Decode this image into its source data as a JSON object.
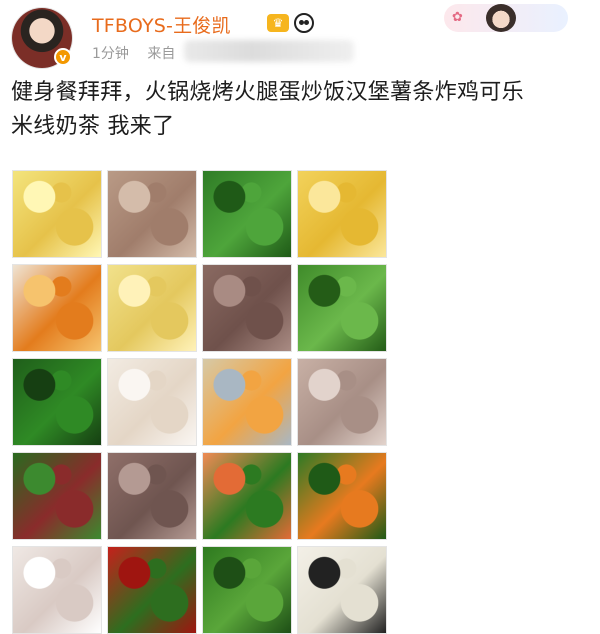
{
  "header": {
    "username": "TFBOYS-王俊凯",
    "time": "1分钟",
    "source_prefix": "来自",
    "verified_badge": "v",
    "crown_icon": "crown-icon",
    "panda_icon": "panda-icon"
  },
  "post": {
    "text_line1": "健身餐拜拜，火锅烧烤火腿蛋炒饭汉堡薯条炸鸡可乐",
    "text_line2": "米线奶茶 我来了"
  },
  "photos": [
    {
      "name": "cabbage-photo",
      "colors": [
        "#f3e47d",
        "#e6c24a",
        "#fff7b5"
      ]
    },
    {
      "name": "meat-photo-1",
      "colors": [
        "#b99a86",
        "#a07d6b",
        "#d4bcaa"
      ]
    },
    {
      "name": "greens-photo-1",
      "colors": [
        "#2f7c26",
        "#4ea53b",
        "#1f5a17"
      ]
    },
    {
      "name": "corn-photo",
      "colors": [
        "#f2d25b",
        "#e5b832",
        "#fbe79b"
      ]
    },
    {
      "name": "chicken-pumpkin-photo",
      "colors": [
        "#efe3d3",
        "#e37c1d",
        "#f6c36d"
      ]
    },
    {
      "name": "cabbage-photo-2",
      "colors": [
        "#f1e18b",
        "#e4c85e",
        "#fff2b9"
      ]
    },
    {
      "name": "beef-photo-1",
      "colors": [
        "#8a6a62",
        "#6f514b",
        "#a98b83"
      ]
    },
    {
      "name": "snap-peas-photo",
      "colors": [
        "#3f8b2a",
        "#6bb84b",
        "#245c17"
      ]
    },
    {
      "name": "spinach-photo",
      "colors": [
        "#1f5e1a",
        "#2f8a25",
        "#163f12"
      ]
    },
    {
      "name": "chicken-photo-2",
      "colors": [
        "#f2ebe2",
        "#e4d6c6",
        "#faf6f2"
      ]
    },
    {
      "name": "lunchbox-photo",
      "colors": [
        "#d6c9a6",
        "#f2a442",
        "#a9b7c3"
      ]
    },
    {
      "name": "meat-photo-2",
      "colors": [
        "#c8b0a5",
        "#a88f86",
        "#e2d3cc"
      ]
    },
    {
      "name": "spinach-tomato-photo",
      "colors": [
        "#2a6a1f",
        "#8a2b2b",
        "#3c8a2f"
      ]
    },
    {
      "name": "beef-photo-2",
      "colors": [
        "#8f6f69",
        "#6f5550",
        "#b49a93"
      ]
    },
    {
      "name": "salmon-broccoli-photo",
      "colors": [
        "#f08b55",
        "#2c7a21",
        "#e36b36"
      ]
    },
    {
      "name": "greens-pumpkin-photo",
      "colors": [
        "#2e7a25",
        "#e77a1f",
        "#1f5a17"
      ]
    },
    {
      "name": "chicken-photo-3",
      "colors": [
        "#efe8e4",
        "#d9cac4",
        "#ffffff"
      ]
    },
    {
      "name": "tomato-photo",
      "colors": [
        "#c5201b",
        "#2d6e1f",
        "#9f1510"
      ]
    },
    {
      "name": "broccoli-photo",
      "colors": [
        "#2e7a1f",
        "#5aa63a",
        "#1e4f16"
      ]
    },
    {
      "name": "dish-photo",
      "colors": [
        "#f3f0e7",
        "#e4e0d2",
        "#222222"
      ]
    }
  ]
}
